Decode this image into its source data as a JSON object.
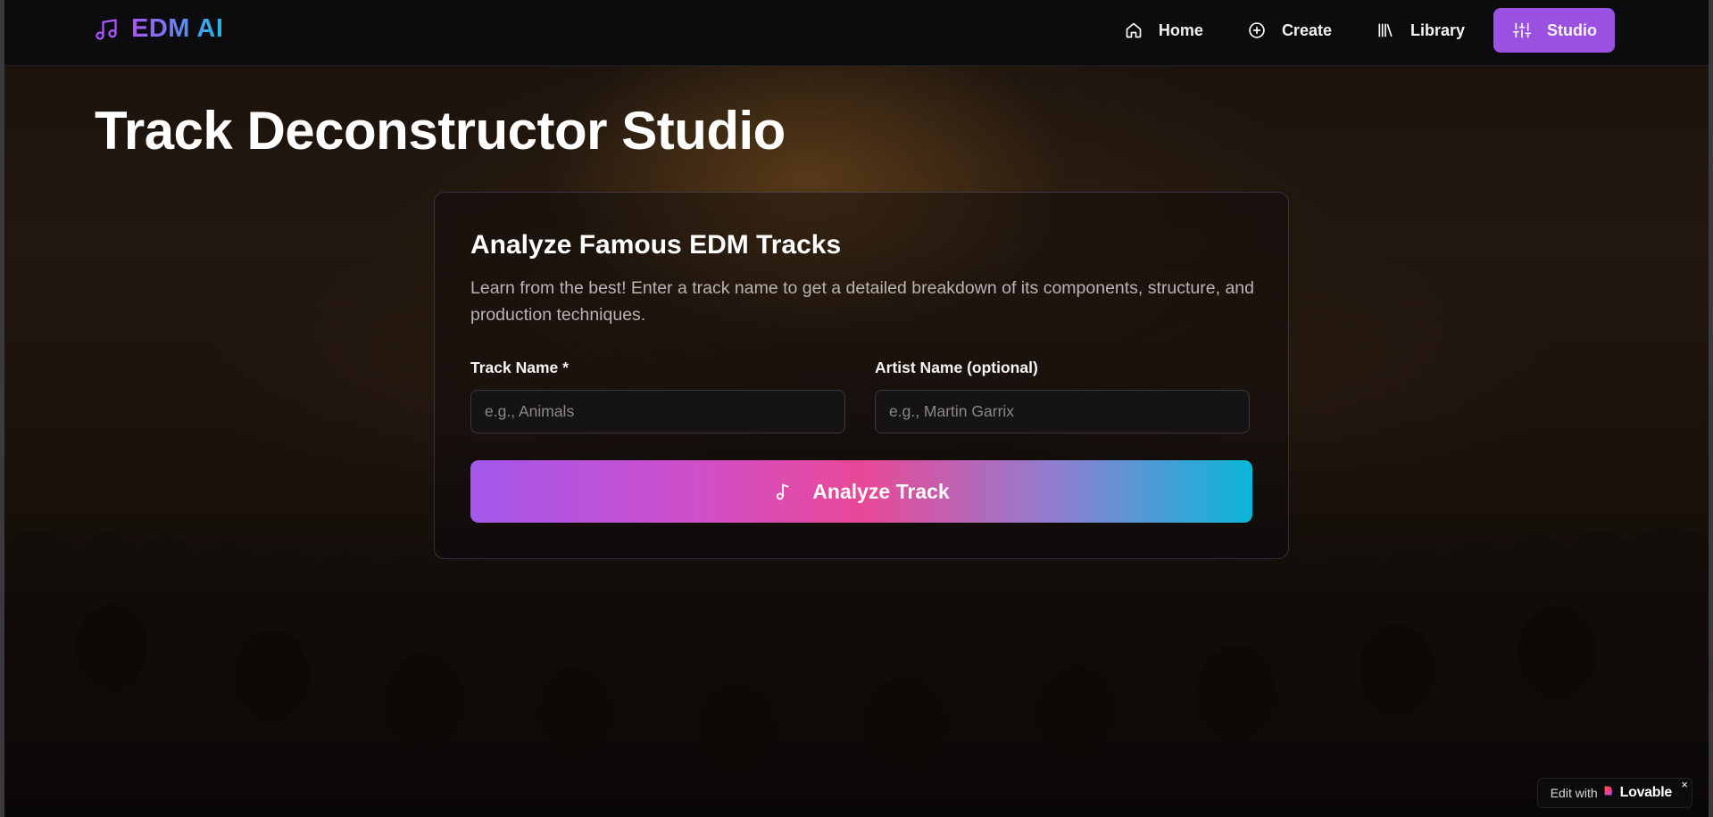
{
  "nav": {
    "brand": "EDM AI",
    "items": [
      {
        "label": "Home",
        "icon": "home-icon",
        "active": false
      },
      {
        "label": "Create",
        "icon": "plus-circle-icon",
        "active": false
      },
      {
        "label": "Library",
        "icon": "library-icon",
        "active": false
      },
      {
        "label": "Studio",
        "icon": "sliders-icon",
        "active": true
      }
    ]
  },
  "main": {
    "title": "Track Deconstructor Studio"
  },
  "analyzer": {
    "title": "Analyze Famous EDM Tracks",
    "description": "Learn from the best! Enter a track name to get a detailed breakdown of its components, structure, and production techniques.",
    "track": {
      "label": "Track Name *",
      "placeholder": "e.g., Animals",
      "value": ""
    },
    "artist": {
      "label": "Artist Name (optional)",
      "placeholder": "e.g., Martin Garrix",
      "value": ""
    },
    "button": {
      "label": "Analyze Track",
      "icon": "music-note-icon"
    }
  },
  "badge": {
    "prefix": "Edit with",
    "brand": "Lovable",
    "close": "×"
  },
  "colors": {
    "accent": "#9b51e0",
    "gradient_start": "#a358ec",
    "gradient_mid": "#e94896",
    "gradient_end": "#0ab7d9",
    "brand_purple": "#a855f7",
    "brand_blue": "#22b7e0"
  }
}
